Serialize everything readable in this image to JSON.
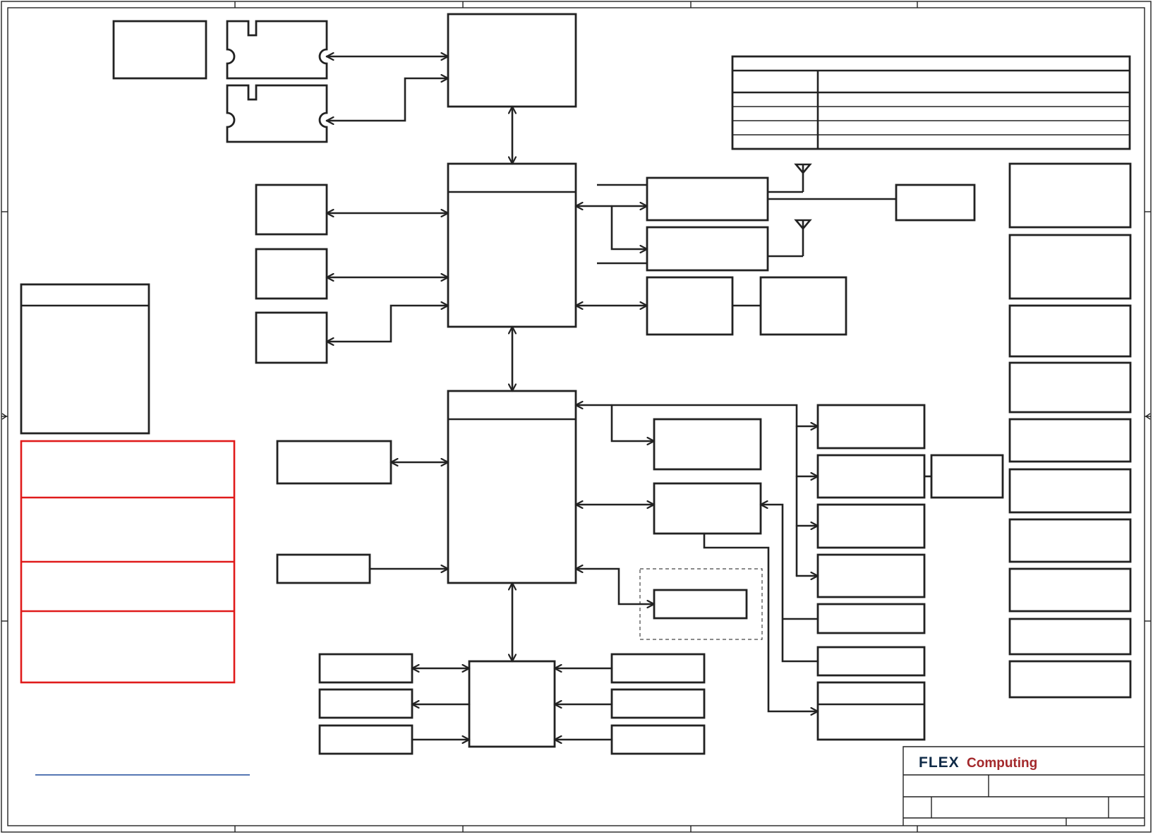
{
  "title_block": {
    "logo_text": "FLEX",
    "logo_accent": "Computing",
    "logo_color": "#0f2a47",
    "accent_color": "#a3282b"
  },
  "colors": {
    "line": "#222222",
    "highlight_frame": "#e01b1b",
    "link_underline": "#1e4a9a"
  },
  "icons": [
    "antenna-icon",
    "antenna-icon",
    "memory-module-icon",
    "memory-module-icon"
  ]
}
